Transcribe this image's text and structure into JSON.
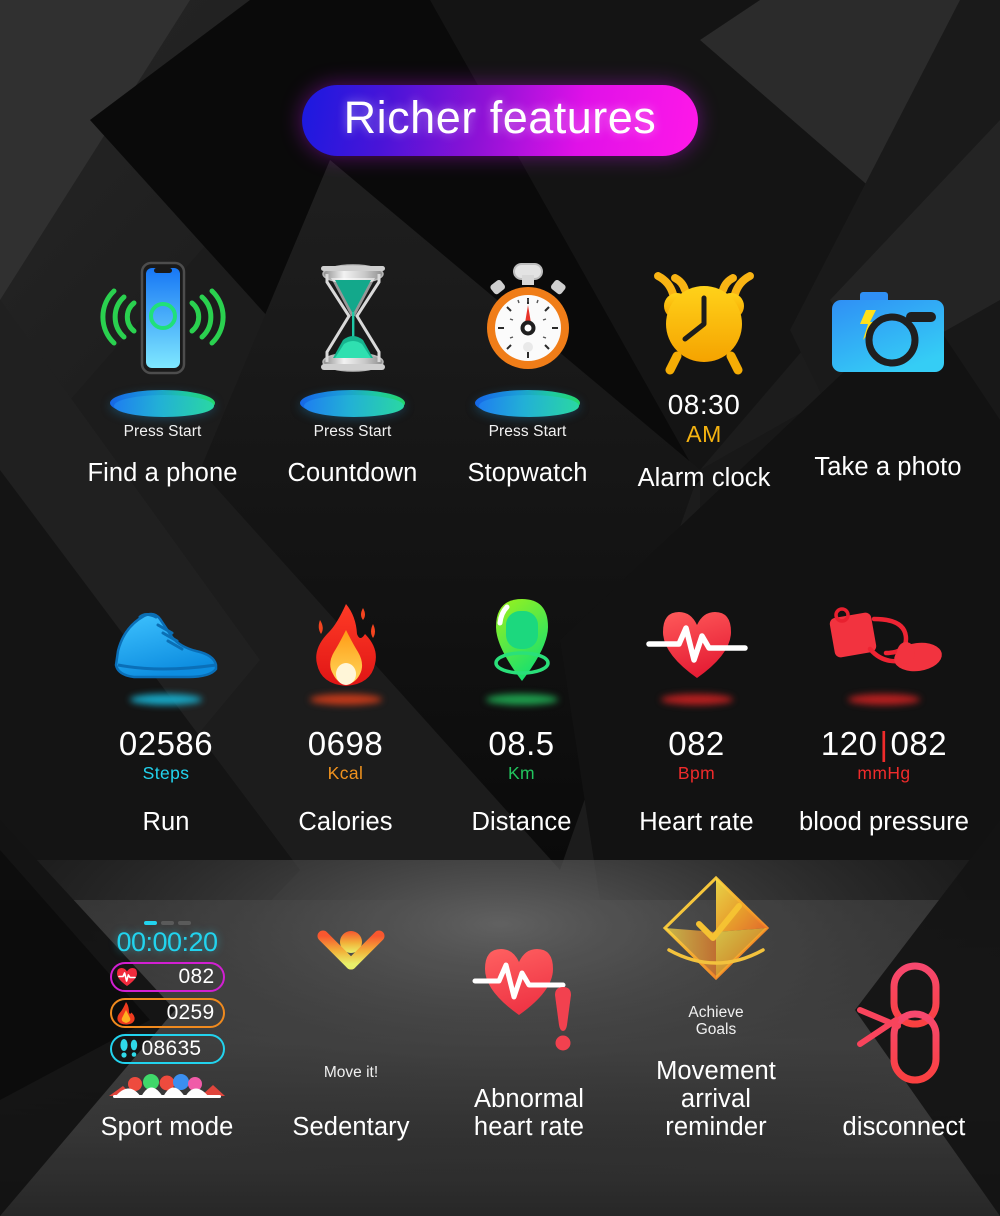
{
  "header": {
    "title": "Richer features",
    "gradient_from": "#1a1ae0",
    "gradient_to": "#ff18e8"
  },
  "theme": {
    "background": "#121212",
    "caption_color": "#ffffff",
    "value_color": "#ffffff"
  },
  "rows": [
    {
      "id": "row-utilities",
      "items": [
        {
          "key": "find-a-phone",
          "icon": "phone-ringing-icon",
          "caption": "Find a phone",
          "sub": "Press Start",
          "accent": "#22c55e"
        },
        {
          "key": "countdown",
          "icon": "hourglass-icon",
          "caption": "Countdown",
          "sub": "Press Start",
          "accent": "#14b8a6"
        },
        {
          "key": "stopwatch",
          "icon": "stopwatch-icon",
          "caption": "Stopwatch",
          "sub": "Press Start",
          "accent": "#f97316"
        },
        {
          "key": "alarm-clock",
          "icon": "alarm-clock-icon",
          "caption": "Alarm clock",
          "time": "08:30",
          "ampm": "AM",
          "accent": "#f5b311"
        },
        {
          "key": "take-a-photo",
          "icon": "camera-icon",
          "caption": "Take a photo",
          "accent": "#29a9f5"
        }
      ]
    },
    {
      "id": "row-metrics",
      "items": [
        {
          "key": "run",
          "icon": "running-shoe-icon",
          "caption": "Run",
          "value": "02586",
          "unit": "Steps",
          "unit_color": "#22d3ee"
        },
        {
          "key": "calories",
          "icon": "flame-icon",
          "caption": "Calories",
          "value": "0698",
          "unit": "Kcal",
          "unit_color": "#f0921e"
        },
        {
          "key": "distance",
          "icon": "map-pin-icon",
          "caption": "Distance",
          "value": "08.5",
          "unit": "Km",
          "unit_color": "#22c55e"
        },
        {
          "key": "heart-rate",
          "icon": "heart-pulse-icon",
          "caption": "Heart rate",
          "value": "082",
          "unit": "Bpm",
          "unit_color": "#ef2b2b"
        },
        {
          "key": "blood-pressure",
          "icon": "blood-pressure-cuff-icon",
          "caption": "blood pressure",
          "value_systolic": "120",
          "value_separator": "|",
          "value_diastolic": "082",
          "unit": "mmHg",
          "unit_color": "#ef2b2b"
        }
      ]
    },
    {
      "id": "row-alerts",
      "items": [
        {
          "key": "sport-mode",
          "icon": "watch-sport-screen-icon",
          "caption": "Sport mode",
          "watch": {
            "timer": "00:00:20",
            "dashes_total": 3,
            "dashes_active": 1,
            "stats": [
              {
                "icon": "heart-icon",
                "value": "082",
                "color": "#d21fd2"
              },
              {
                "icon": "flame-icon",
                "value": "0259",
                "color": "#f08a1e"
              },
              {
                "icon": "footsteps-icon",
                "value": "08635",
                "color": "#22d3ee"
              }
            ]
          }
        },
        {
          "key": "sedentary",
          "icon": "person-arms-up-icon",
          "caption": "Sedentary",
          "sub": "Move it!"
        },
        {
          "key": "abnormal-heart-rate",
          "icon": "heart-alert-icon",
          "caption": "Abnormal\nheart rate",
          "caption_line1": "Abnormal",
          "caption_line2": "heart rate"
        },
        {
          "key": "movement-arrival-reminder",
          "icon": "goal-badge-icon",
          "caption_line1": "Movement arrival",
          "caption_line2": "reminder",
          "sub_line1": "Achieve",
          "sub_line2": "Goals"
        },
        {
          "key": "disconnect",
          "icon": "broken-chain-icon",
          "caption": "disconnect"
        }
      ]
    }
  ]
}
